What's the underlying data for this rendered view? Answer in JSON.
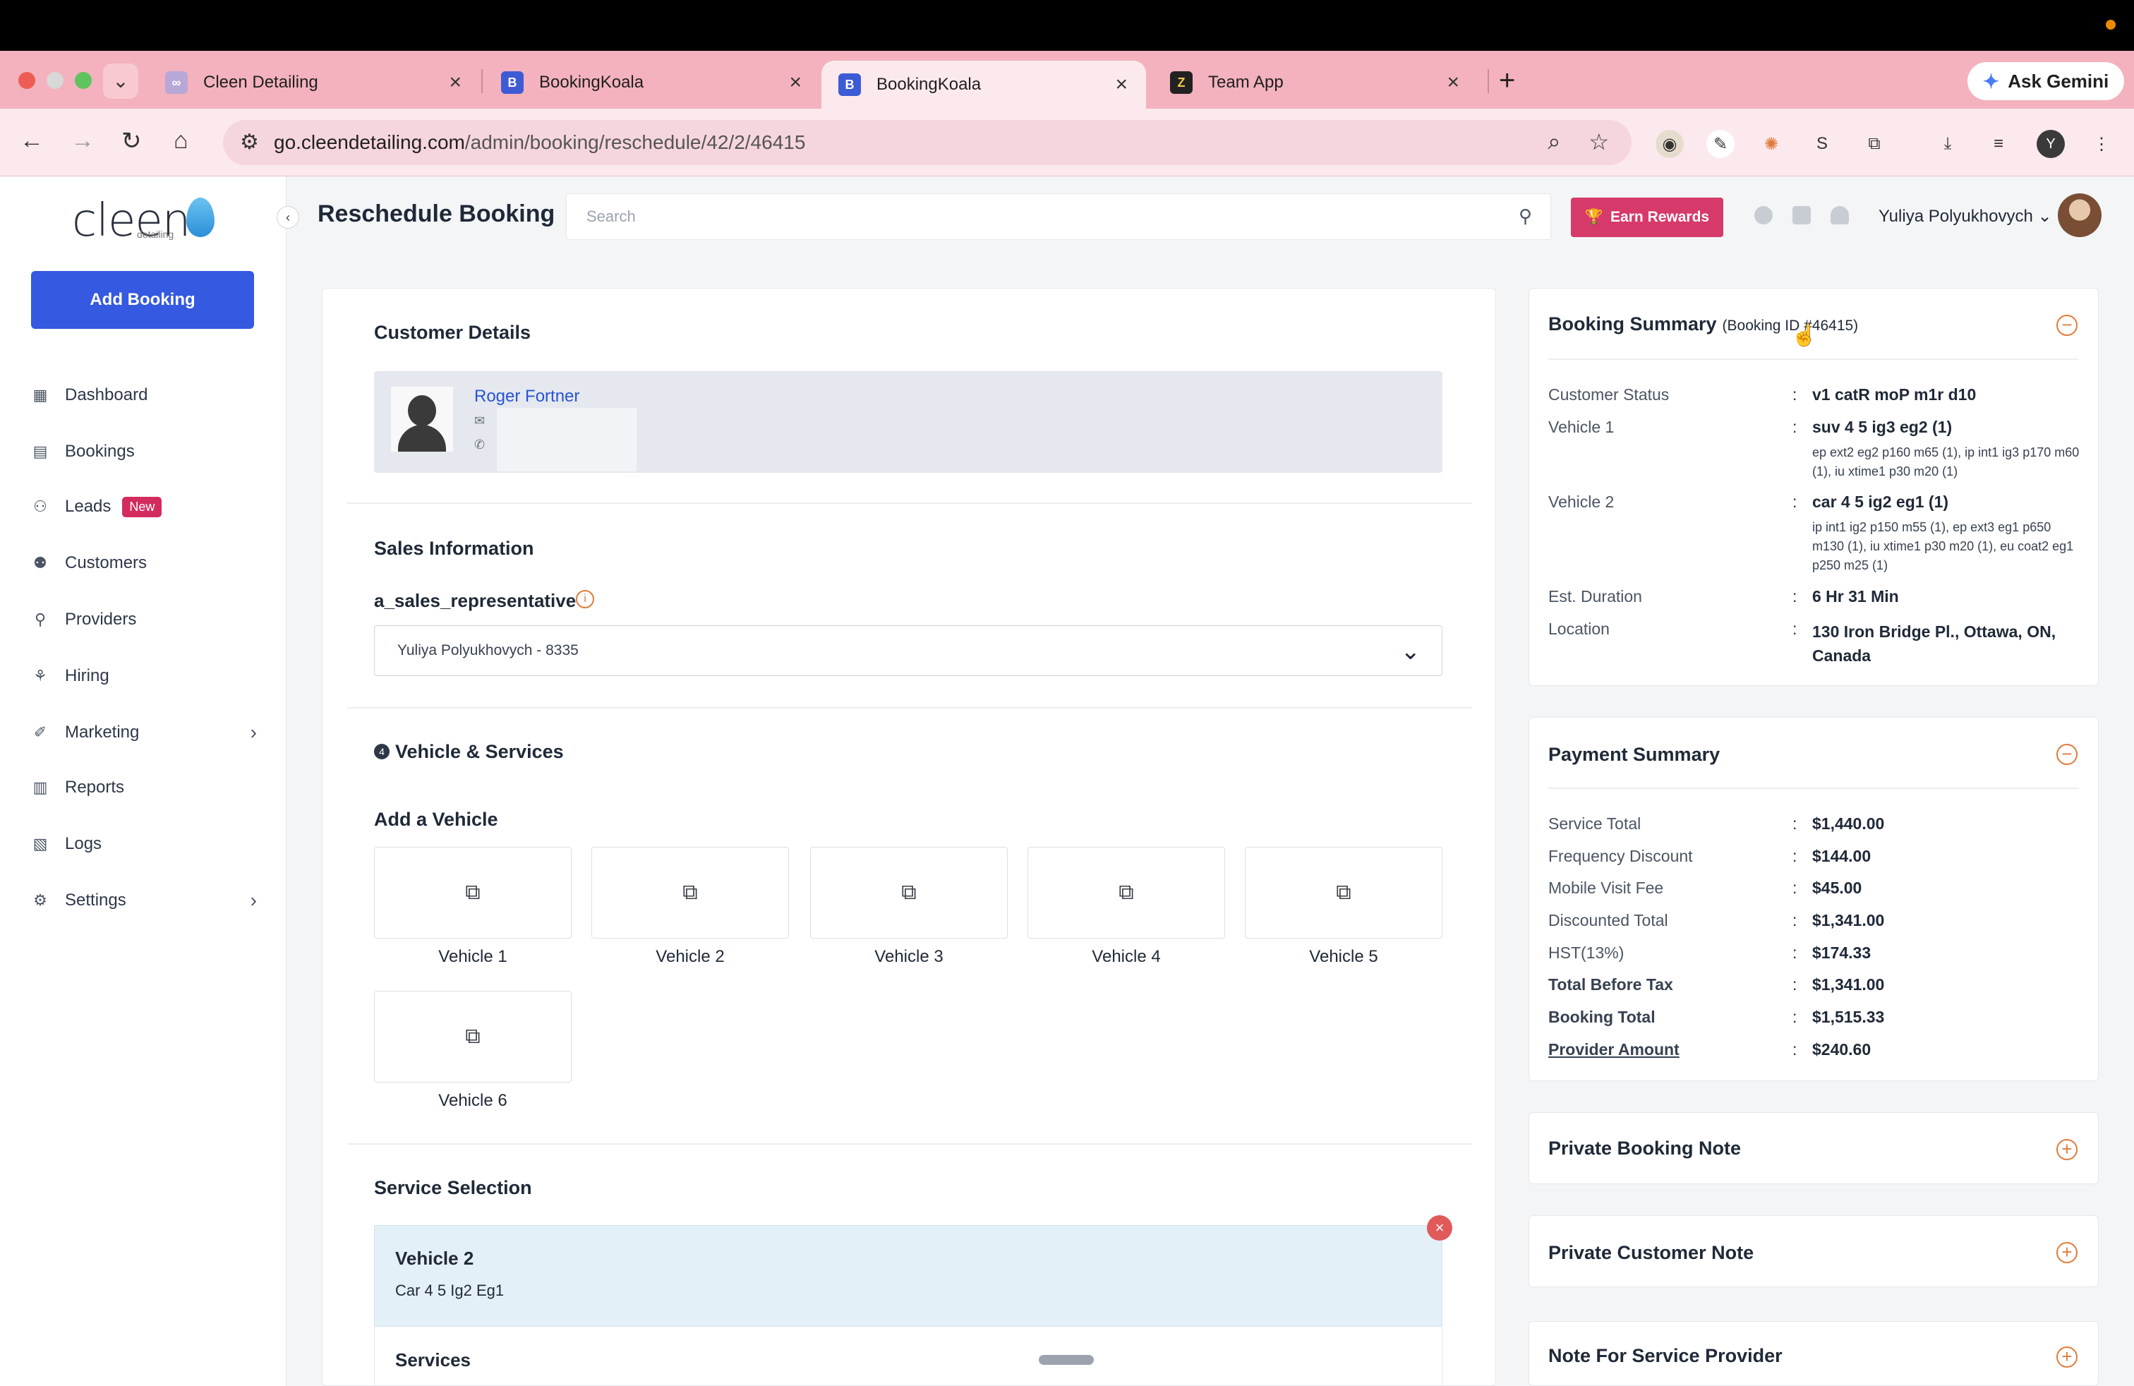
{
  "browser": {
    "tabs": [
      {
        "title": "Cleen Detailing",
        "favicon": "cleen-favicon"
      },
      {
        "title": "BookingKoala",
        "favicon": "bookingkoala-favicon"
      },
      {
        "title": "BookingKoala",
        "favicon": "bookingkoala-favicon"
      },
      {
        "title": "Team App",
        "favicon": "team-app-favicon"
      }
    ],
    "active_tab_index": 2,
    "url_domain": "go.cleendetailing.com",
    "url_path": "/admin/booking/reschedule/42/2/46415",
    "gemini_label": "Ask Gemini",
    "profile_initial": "Y"
  },
  "sidebar": {
    "logo_text": "cleen",
    "logo_sub": "detailing",
    "add_booking": "Add Booking",
    "items": [
      {
        "label": "Dashboard",
        "icon": "dashboard-icon"
      },
      {
        "label": "Bookings",
        "icon": "calendar-icon"
      },
      {
        "label": "Leads",
        "icon": "leads-icon",
        "badge": "New"
      },
      {
        "label": "Customers",
        "icon": "customers-icon"
      },
      {
        "label": "Providers",
        "icon": "providers-icon"
      },
      {
        "label": "Hiring",
        "icon": "hiring-icon"
      },
      {
        "label": "Marketing",
        "icon": "marketing-icon",
        "expandable": true
      },
      {
        "label": "Reports",
        "icon": "reports-icon"
      },
      {
        "label": "Logs",
        "icon": "logs-icon"
      },
      {
        "label": "Settings",
        "icon": "settings-icon",
        "expandable": true
      }
    ]
  },
  "header": {
    "page_title": "Reschedule Booking",
    "search_placeholder": "Search",
    "earn_rewards": "Earn Rewards",
    "user_name": "Yuliya Polyukhovych"
  },
  "main": {
    "customer_details_title": "Customer Details",
    "customer_name": "Roger Fortner",
    "sales_info_title": "Sales Information",
    "sales_rep_label": "a_sales_representative",
    "sales_rep_value": "Yuliya Polyukhovych - 8335",
    "vehicle_services_title": "Vehicle & Services",
    "add_vehicle_title": "Add a Vehicle",
    "vehicles": [
      "Vehicle 1",
      "Vehicle 2",
      "Vehicle 3",
      "Vehicle 4",
      "Vehicle 5",
      "Vehicle 6"
    ],
    "service_selection_title": "Service Selection",
    "selected_vehicle": "Vehicle 2",
    "selected_vehicle_desc": "Car 4 5 Ig2 Eg1",
    "services_label": "Services"
  },
  "booking_summary": {
    "title": "Booking Summary",
    "booking_id": "(Booking ID #46415)",
    "rows": [
      {
        "key": "Customer Status",
        "value": "v1 catR moP m1r d10"
      },
      {
        "key": "Vehicle 1",
        "value": "suv 4 5 ig3 eg2 (1)",
        "detail": "ep ext2 eg2 p160 m65 (1), ip int1 ig3 p170 m60 (1), iu xtime1 p30 m20 (1)"
      },
      {
        "key": "Vehicle 2",
        "value": "car 4 5 ig2 eg1 (1)",
        "detail": "ip int1 ig2 p150 m55 (1), ep ext3 eg1 p650 m130 (1), iu xtime1 p30 m20 (1), eu coat2 eg1 p250 m25 (1)"
      },
      {
        "key": "Est. Duration",
        "value": "6 Hr 31 Min"
      },
      {
        "key": "Location",
        "value": "130 Iron Bridge Pl., Ottawa, ON, Canada"
      }
    ]
  },
  "payment_summary": {
    "title": "Payment Summary",
    "rows": [
      {
        "key": "Service Total",
        "value": "$1,440.00"
      },
      {
        "key": "Frequency Discount",
        "value": "$144.00"
      },
      {
        "key": "Mobile Visit Fee",
        "value": "$45.00"
      },
      {
        "key": "Discounted Total",
        "value": "$1,341.00"
      },
      {
        "key": "HST(13%)",
        "value": "$174.33"
      },
      {
        "key": "Total Before Tax",
        "value": "$1,341.00"
      },
      {
        "key": "Booking Total",
        "value": "$1,515.33"
      },
      {
        "key": "Provider Amount",
        "value": "$240.60"
      }
    ]
  },
  "notes": {
    "private_booking_note": "Private Booking Note",
    "private_customer_note": "Private Customer Note",
    "note_for_provider": "Note For Service Provider"
  },
  "colors": {
    "primary_button": "#3559e0",
    "earn_rewards": "#d63a6a",
    "link": "#2754d6",
    "accent_orange": "#e07b3a",
    "tab_strip": "#f3b2bd"
  }
}
